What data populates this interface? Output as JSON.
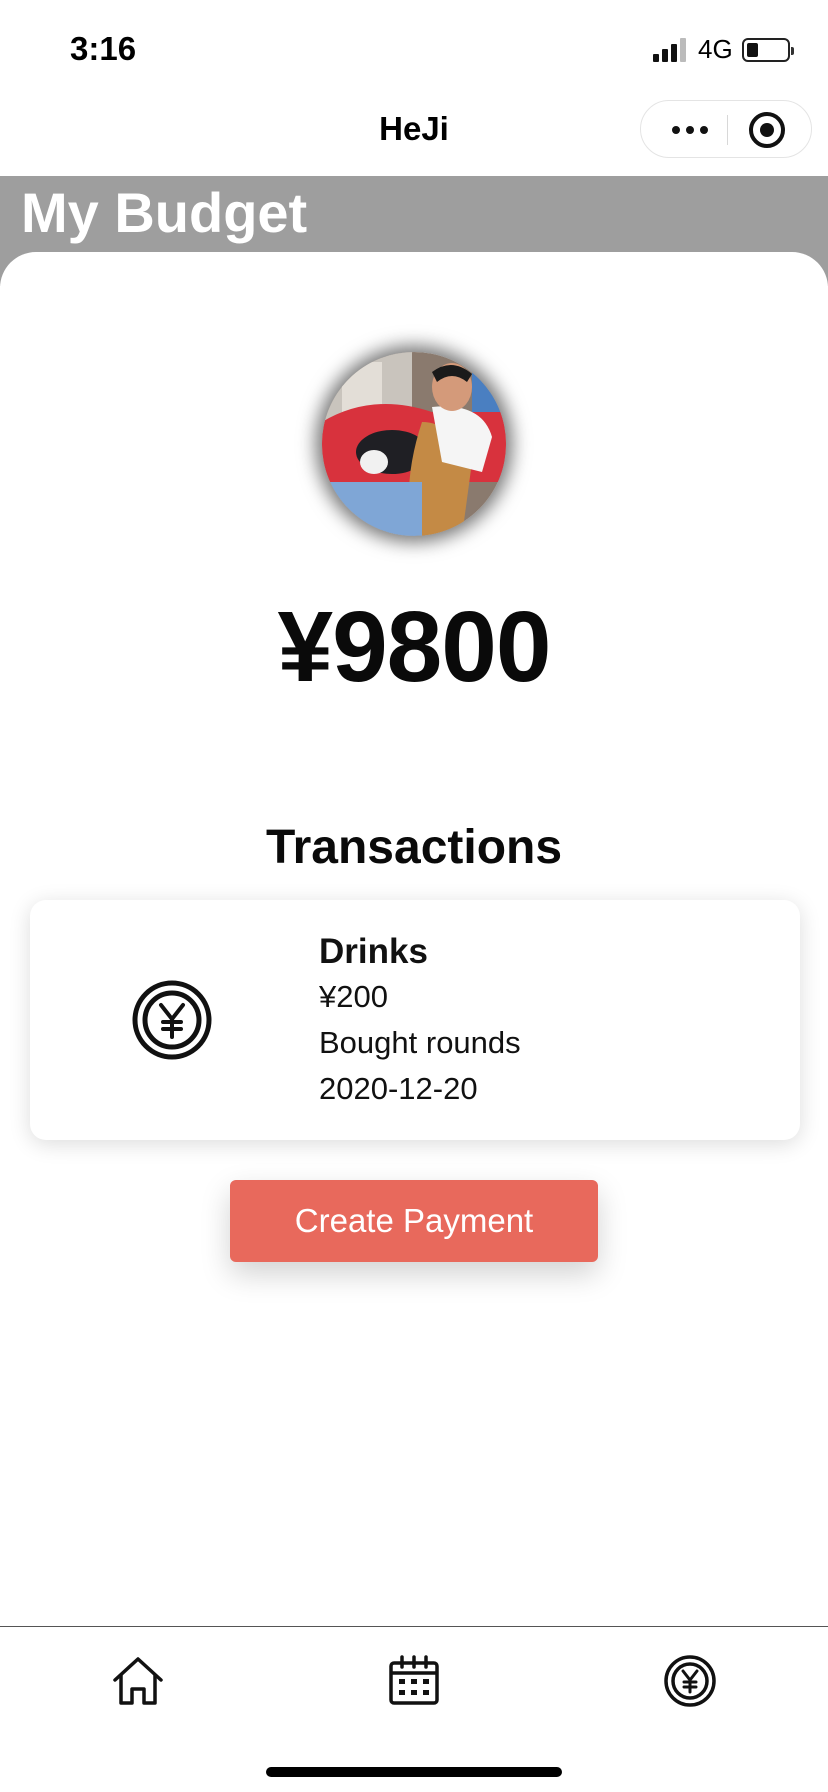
{
  "status_bar": {
    "time": "3:16",
    "network": "4G"
  },
  "nav": {
    "title": "HeJi",
    "more_icon": "more-dots-icon",
    "close_icon": "target-close-icon"
  },
  "header": {
    "title": "My Budget",
    "background": "#9e9e9e"
  },
  "profile": {
    "avatar_icon": "user-avatar-photo"
  },
  "budget": {
    "amount": "¥9800"
  },
  "transactions": {
    "title": "Transactions",
    "items": [
      {
        "icon": "yen-coin-icon",
        "name": "Drinks",
        "amount": "¥200",
        "note": "Bought rounds",
        "date": "2020-12-20"
      }
    ]
  },
  "actions": {
    "create_payment_label": "Create Payment",
    "accent": "#e8695c"
  },
  "tab_bar": {
    "items": [
      {
        "icon": "home-icon",
        "name": "home"
      },
      {
        "icon": "calendar-icon",
        "name": "calendar"
      },
      {
        "icon": "yen-coin-icon",
        "name": "budget"
      }
    ]
  }
}
